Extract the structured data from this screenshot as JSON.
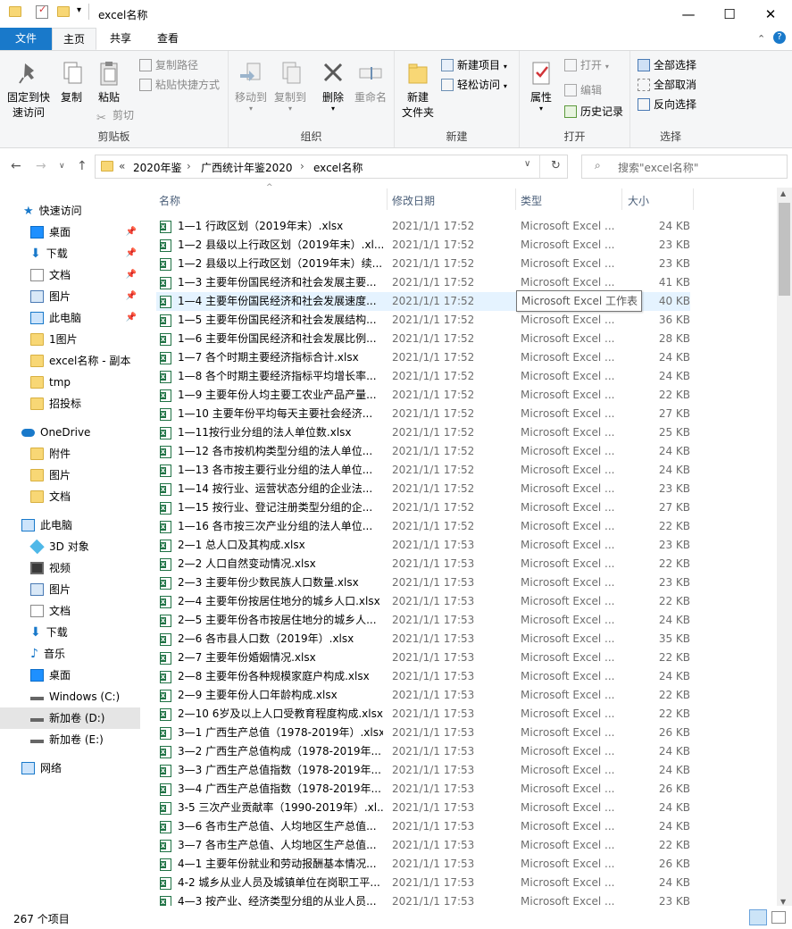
{
  "window": {
    "title": "excel名称",
    "min": "—",
    "max": "☐",
    "close": "✕"
  },
  "tabs": [
    {
      "label": "文件"
    },
    {
      "label": "主页"
    },
    {
      "label": "共享"
    },
    {
      "label": "查看"
    }
  ],
  "ribbon": {
    "clipboard": {
      "label": "剪贴板",
      "pin": "固定到快\n速访问",
      "copy": "复制",
      "paste": "粘贴",
      "copy_path": "复制路径",
      "paste_shortcut": "粘贴快捷方式",
      "cut": "剪切"
    },
    "organize": {
      "label": "组织",
      "move_to": "移动到",
      "copy_to": "复制到",
      "delete": "删除",
      "rename": "重命名"
    },
    "new": {
      "label": "新建",
      "new_folder": "新建\n文件夹",
      "new_item": "新建项目",
      "easy_access": "轻松访问"
    },
    "open": {
      "label": "打开",
      "properties": "属性",
      "open": "打开",
      "edit": "编辑",
      "history": "历史记录"
    },
    "select": {
      "label": "选择",
      "select_all": "全部选择",
      "select_none": "全部取消",
      "invert": "反向选择"
    }
  },
  "address": {
    "crumbs": [
      "«",
      "2020年鉴",
      "广西统计年鉴2020",
      "excel名称"
    ],
    "search_placeholder": "搜索\"excel名称\""
  },
  "nav": {
    "items": [
      {
        "label": "快速访问",
        "icon": "star-icon"
      },
      {
        "label": "桌面",
        "icon": "desktop-icon",
        "pinned": true
      },
      {
        "label": "下载",
        "icon": "download-icon",
        "pinned": true
      },
      {
        "label": "文档",
        "icon": "document-icon",
        "pinned": true
      },
      {
        "label": "图片",
        "icon": "picture-icon",
        "pinned": true
      },
      {
        "label": "此电脑",
        "icon": "computer-icon",
        "pinned": true
      },
      {
        "label": "1图片",
        "icon": "folder-icon"
      },
      {
        "label": "excel名称 - 副本",
        "icon": "folder-icon"
      },
      {
        "label": "tmp",
        "icon": "folder-icon"
      },
      {
        "label": "招投标",
        "icon": "folder-icon"
      },
      {
        "label": "OneDrive",
        "icon": "cloud-icon"
      },
      {
        "label": "附件",
        "icon": "folder-icon"
      },
      {
        "label": "图片",
        "icon": "folder-icon"
      },
      {
        "label": "文档",
        "icon": "folder-icon"
      },
      {
        "label": "此电脑",
        "icon": "computer-icon"
      },
      {
        "label": "3D 对象",
        "icon": "3d-icon"
      },
      {
        "label": "视频",
        "icon": "video-icon"
      },
      {
        "label": "图片",
        "icon": "picture-icon"
      },
      {
        "label": "文档",
        "icon": "document-icon"
      },
      {
        "label": "下载",
        "icon": "download-icon"
      },
      {
        "label": "音乐",
        "icon": "music-icon"
      },
      {
        "label": "桌面",
        "icon": "desktop-icon"
      },
      {
        "label": "Windows (C:)",
        "icon": "drive-icon"
      },
      {
        "label": "新加卷 (D:)",
        "icon": "drive-icon"
      },
      {
        "label": "新加卷 (E:)",
        "icon": "drive-icon"
      },
      {
        "label": "网络",
        "icon": "network-icon"
      }
    ]
  },
  "columns": {
    "name": "名称",
    "date": "修改日期",
    "type": "类型",
    "size": "大小"
  },
  "files": [
    {
      "name": "1—1 行政区划（2019年末）.xlsx",
      "date": "2021/1/1 17:52",
      "type": "Microsoft Excel ...",
      "size": "24 KB"
    },
    {
      "name": "1—2 县级以上行政区划（2019年末）.xl...",
      "date": "2021/1/1 17:52",
      "type": "Microsoft Excel ...",
      "size": "23 KB"
    },
    {
      "name": "1—2 县级以上行政区划（2019年末）续...",
      "date": "2021/1/1 17:52",
      "type": "Microsoft Excel ...",
      "size": "23 KB"
    },
    {
      "name": "1—3 主要年份国民经济和社会发展主要...",
      "date": "2021/1/1 17:52",
      "type": "Microsoft Excel ...",
      "size": "41 KB"
    },
    {
      "name": "1—4 主要年份国民经济和社会发展速度...",
      "date": "2021/1/1 17:52",
      "type": "Microsoft Excel ...",
      "size": "40 KB"
    },
    {
      "name": "1—5 主要年份国民经济和社会发展结构...",
      "date": "2021/1/1 17:52",
      "type": "Microsoft Excel ...",
      "size": "36 KB"
    },
    {
      "name": "1—6 主要年份国民经济和社会发展比例...",
      "date": "2021/1/1 17:52",
      "type": "Microsoft Excel ...",
      "size": "28 KB"
    },
    {
      "name": "1—7 各个时期主要经济指标合计.xlsx",
      "date": "2021/1/1 17:52",
      "type": "Microsoft Excel ...",
      "size": "24 KB"
    },
    {
      "name": "1—8 各个时期主要经济指标平均增长率...",
      "date": "2021/1/1 17:52",
      "type": "Microsoft Excel ...",
      "size": "24 KB"
    },
    {
      "name": "1—9 主要年份人均主要工农业产品产量...",
      "date": "2021/1/1 17:52",
      "type": "Microsoft Excel ...",
      "size": "22 KB"
    },
    {
      "name": "1—10 主要年份平均每天主要社会经济...",
      "date": "2021/1/1 17:52",
      "type": "Microsoft Excel ...",
      "size": "27 KB"
    },
    {
      "name": "1—11按行业分组的法人单位数.xlsx",
      "date": "2021/1/1 17:52",
      "type": "Microsoft Excel ...",
      "size": "25 KB"
    },
    {
      "name": "1—12 各市按机构类型分组的法人单位...",
      "date": "2021/1/1 17:52",
      "type": "Microsoft Excel ...",
      "size": "24 KB"
    },
    {
      "name": "1—13 各市按主要行业分组的法人单位...",
      "date": "2021/1/1 17:52",
      "type": "Microsoft Excel ...",
      "size": "24 KB"
    },
    {
      "name": "1—14 按行业、运营状态分组的企业法...",
      "date": "2021/1/1 17:52",
      "type": "Microsoft Excel ...",
      "size": "23 KB"
    },
    {
      "name": "1—15 按行业、登记注册类型分组的企...",
      "date": "2021/1/1 17:52",
      "type": "Microsoft Excel ...",
      "size": "27 KB"
    },
    {
      "name": "1—16 各市按三次产业分组的法人单位...",
      "date": "2021/1/1 17:52",
      "type": "Microsoft Excel ...",
      "size": "22 KB"
    },
    {
      "name": "2—1 总人口及其构成.xlsx",
      "date": "2021/1/1 17:53",
      "type": "Microsoft Excel ...",
      "size": "23 KB"
    },
    {
      "name": "2—2 人口自然变动情况.xlsx",
      "date": "2021/1/1 17:53",
      "type": "Microsoft Excel ...",
      "size": "22 KB"
    },
    {
      "name": "2—3 主要年份少数民族人口数量.xlsx",
      "date": "2021/1/1 17:53",
      "type": "Microsoft Excel ...",
      "size": "23 KB"
    },
    {
      "name": "2—4 主要年份按居住地分的城乡人口.xlsx",
      "date": "2021/1/1 17:53",
      "type": "Microsoft Excel ...",
      "size": "22 KB"
    },
    {
      "name": "2—5 主要年份各市按居住地分的城乡人...",
      "date": "2021/1/1 17:53",
      "type": "Microsoft Excel ...",
      "size": "24 KB"
    },
    {
      "name": "2—6 各市县人口数（2019年）.xlsx",
      "date": "2021/1/1 17:53",
      "type": "Microsoft Excel ...",
      "size": "35 KB"
    },
    {
      "name": "2—7 主要年份婚姻情况.xlsx",
      "date": "2021/1/1 17:53",
      "type": "Microsoft Excel ...",
      "size": "22 KB"
    },
    {
      "name": "2—8 主要年份各种规模家庭户构成.xlsx",
      "date": "2021/1/1 17:53",
      "type": "Microsoft Excel ...",
      "size": "24 KB"
    },
    {
      "name": "2—9 主要年份人口年龄构成.xlsx",
      "date": "2021/1/1 17:53",
      "type": "Microsoft Excel ...",
      "size": "22 KB"
    },
    {
      "name": "2—10 6岁及以上人口受教育程度构成.xlsx",
      "date": "2021/1/1 17:53",
      "type": "Microsoft Excel ...",
      "size": "22 KB"
    },
    {
      "name": "3—1 广西生产总值（1978-2019年）.xlsx",
      "date": "2021/1/1 17:53",
      "type": "Microsoft Excel ...",
      "size": "26 KB"
    },
    {
      "name": "3—2 广西生产总值构成（1978-2019年...",
      "date": "2021/1/1 17:53",
      "type": "Microsoft Excel ...",
      "size": "24 KB"
    },
    {
      "name": "3—3 广西生产总值指数（1978-2019年...",
      "date": "2021/1/1 17:53",
      "type": "Microsoft Excel ...",
      "size": "24 KB"
    },
    {
      "name": "3—4 广西生产总值指数（1978-2019年...",
      "date": "2021/1/1 17:53",
      "type": "Microsoft Excel ...",
      "size": "26 KB"
    },
    {
      "name": "3-5 三次产业贡献率（1990-2019年）.xl...",
      "date": "2021/1/1 17:53",
      "type": "Microsoft Excel ...",
      "size": "24 KB"
    },
    {
      "name": "3—6 各市生产总值、人均地区生产总值...",
      "date": "2021/1/1 17:53",
      "type": "Microsoft Excel ...",
      "size": "24 KB"
    },
    {
      "name": "3—7 各市生产总值、人均地区生产总值...",
      "date": "2021/1/1 17:53",
      "type": "Microsoft Excel ...",
      "size": "22 KB"
    },
    {
      "name": "4—1 主要年份就业和劳动报酬基本情况...",
      "date": "2021/1/1 17:53",
      "type": "Microsoft Excel ...",
      "size": "26 KB"
    },
    {
      "name": "4-2 城乡从业人员及城镇单位在岗职工平...",
      "date": "2021/1/1 17:53",
      "type": "Microsoft Excel ...",
      "size": "24 KB"
    },
    {
      "name": "4—3 按产业、经济类型分组的从业人员...",
      "date": "2021/1/1 17:53",
      "type": "Microsoft Excel ...",
      "size": "23 KB"
    }
  ],
  "tooltip": "Microsoft Excel 工作表",
  "status": {
    "count": "267 个项目"
  }
}
